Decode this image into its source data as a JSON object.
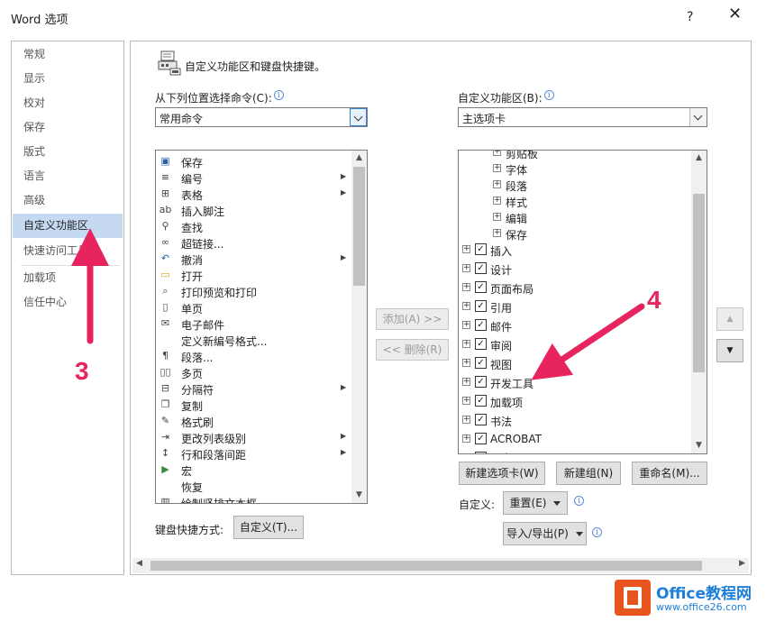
{
  "window": {
    "title": "Word 选项",
    "help": "?",
    "close": "✕"
  },
  "sidebar": {
    "items": [
      {
        "label": "常规"
      },
      {
        "label": "显示"
      },
      {
        "label": "校对"
      },
      {
        "label": "保存"
      },
      {
        "label": "版式"
      },
      {
        "label": "语言"
      },
      {
        "label": "高级"
      },
      {
        "label": "自定义功能区",
        "selected": true
      },
      {
        "label": "快速访问工具栏"
      },
      {
        "label": "加载项"
      },
      {
        "label": "信任中心"
      }
    ]
  },
  "main": {
    "heading": "自定义功能区和键盘快捷键。",
    "left": {
      "label": "从下列位置选择命令(C):",
      "combo_value": "常用命令",
      "commands": [
        {
          "label": "保存",
          "icon": "save-icon",
          "submenu": false
        },
        {
          "label": "编号",
          "icon": "numbering-icon",
          "submenu": true
        },
        {
          "label": "表格",
          "icon": "table-icon",
          "submenu": true
        },
        {
          "label": "插入脚注",
          "icon": "footnote-icon",
          "submenu": false
        },
        {
          "label": "查找",
          "icon": "find-icon",
          "submenu": false
        },
        {
          "label": "超链接...",
          "icon": "hyperlink-icon",
          "submenu": false
        },
        {
          "label": "撤消",
          "icon": "undo-icon",
          "submenu": true
        },
        {
          "label": "打开",
          "icon": "open-folder-icon",
          "submenu": false
        },
        {
          "label": "打印预览和打印",
          "icon": "print-preview-icon",
          "submenu": false
        },
        {
          "label": "单页",
          "icon": "single-page-icon",
          "submenu": false
        },
        {
          "label": "电子邮件",
          "icon": "email-icon",
          "submenu": false
        },
        {
          "label": "定义新编号格式...",
          "icon": "",
          "submenu": false
        },
        {
          "label": "段落...",
          "icon": "paragraph-icon",
          "submenu": false
        },
        {
          "label": "多页",
          "icon": "multi-page-icon",
          "submenu": false
        },
        {
          "label": "分隔符",
          "icon": "breaks-icon",
          "submenu": true
        },
        {
          "label": "复制",
          "icon": "copy-icon",
          "submenu": false
        },
        {
          "label": "格式刷",
          "icon": "format-painter-icon",
          "submenu": false
        },
        {
          "label": "更改列表级别",
          "icon": "list-level-icon",
          "submenu": true
        },
        {
          "label": "行和段落间距",
          "icon": "line-spacing-icon",
          "submenu": true
        },
        {
          "label": "宏",
          "icon": "macro-icon",
          "submenu": false
        },
        {
          "label": "恢复",
          "icon": "",
          "submenu": false
        },
        {
          "label": "绘制竖排文本框",
          "icon": "vertical-textbox-icon",
          "submenu": false
        }
      ],
      "shortcut_label": "键盘快捷方式:",
      "shortcut_button": "自定义(T)..."
    },
    "middle": {
      "add_button": "添加(A) >>",
      "remove_button": "<< 删除(R)"
    },
    "right": {
      "label": "自定义功能区(B):",
      "combo_value": "主选项卡",
      "tree": [
        {
          "label": "剪贴板",
          "level": 2
        },
        {
          "label": "字体",
          "level": 2
        },
        {
          "label": "段落",
          "level": 2
        },
        {
          "label": "样式",
          "level": 2
        },
        {
          "label": "编辑",
          "level": 2
        },
        {
          "label": "保存",
          "level": 2
        },
        {
          "label": "插入",
          "level": 1,
          "checked": true
        },
        {
          "label": "设计",
          "level": 1,
          "checked": true
        },
        {
          "label": "页面布局",
          "level": 1,
          "checked": true
        },
        {
          "label": "引用",
          "level": 1,
          "checked": true
        },
        {
          "label": "邮件",
          "level": 1,
          "checked": true
        },
        {
          "label": "审阅",
          "level": 1,
          "checked": true
        },
        {
          "label": "视图",
          "level": 1,
          "checked": true
        },
        {
          "label": "开发工具",
          "level": 1,
          "checked": true
        },
        {
          "label": "加载项",
          "level": 1,
          "checked": true
        },
        {
          "label": "书法",
          "level": 1,
          "checked": true
        },
        {
          "label": "ACROBAT",
          "level": 1,
          "checked": true
        },
        {
          "label": "Writer",
          "level": 1,
          "checked": true
        }
      ],
      "new_tab_button": "新建选项卡(W)",
      "new_group_button": "新建组(N)",
      "rename_button": "重命名(M)...",
      "customize_label": "自定义:",
      "reset_button": "重置(E)",
      "import_export_button": "导入/导出(P)"
    }
  },
  "annotations": {
    "step3": "3",
    "step4": "4",
    "accent_color": "#e8245f"
  },
  "watermark": {
    "brand": "Office教程网",
    "url": "www.office26.com"
  }
}
